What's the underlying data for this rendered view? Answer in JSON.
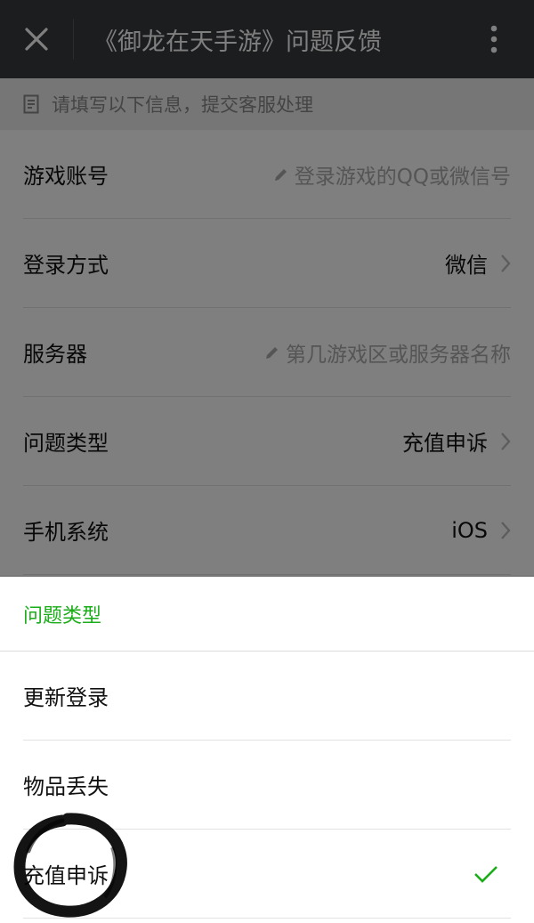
{
  "header": {
    "title": "《御龙在天手游》问题反馈",
    "close_icon": "close-icon",
    "more_icon": "more-vertical-icon"
  },
  "notice": {
    "text": "请填写以下信息，提交客服处理",
    "icon": "form-icon"
  },
  "form": {
    "rows": [
      {
        "label": "游戏账号",
        "placeholder": "登录游戏的QQ或微信号"
      },
      {
        "label": "登录方式",
        "value": "微信"
      },
      {
        "label": "服务器",
        "placeholder": "第几游戏区或服务器名称"
      },
      {
        "label": "问题类型",
        "value": "充值申诉"
      },
      {
        "label": "手机系统",
        "value": "iOS"
      }
    ]
  },
  "sheet": {
    "title": "问题类型",
    "options": [
      {
        "label": "更新登录",
        "selected": false
      },
      {
        "label": "物品丢失",
        "selected": false
      },
      {
        "label": "充值申诉",
        "selected": true
      }
    ]
  },
  "colors": {
    "header_bg": "#383a3f",
    "accent_green": "#1aad19",
    "overlay": "rgba(0,0,0,0.5)"
  }
}
